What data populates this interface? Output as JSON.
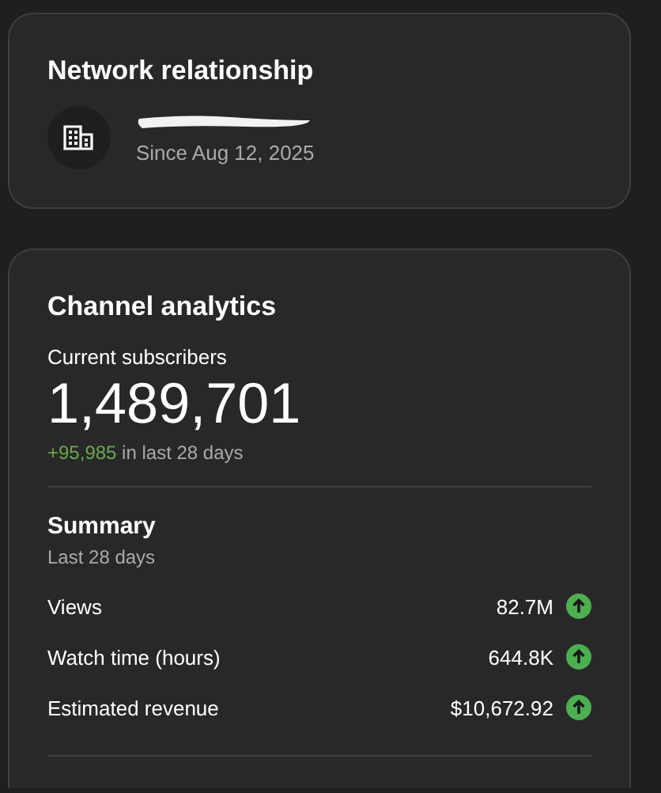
{
  "network": {
    "title": "Network relationship",
    "since": "Since Aug 12, 2025"
  },
  "analytics": {
    "title": "Channel analytics",
    "subscribers_label": "Current subscribers",
    "subscribers": "1,489,701",
    "change": "+95,985",
    "change_suffix": "in last 28 days",
    "summary": {
      "title": "Summary",
      "period": "Last 28 days",
      "metrics": [
        {
          "label": "Views",
          "value": "82.7M",
          "increasing": true
        },
        {
          "label": "Watch time (hours)",
          "value": "644.8K",
          "increasing": true
        },
        {
          "label": "Estimated revenue",
          "value": "$10,672.92",
          "increasing": true
        }
      ]
    }
  }
}
